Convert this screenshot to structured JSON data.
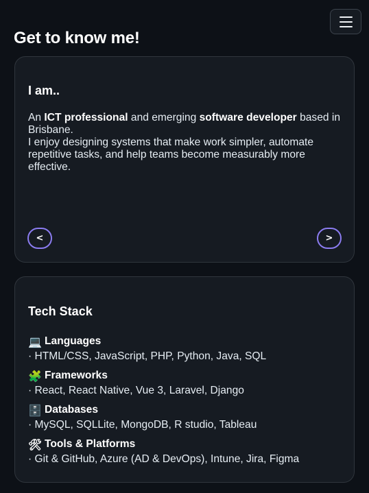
{
  "header": {
    "menu_icon": "hamburger-menu-icon"
  },
  "page": {
    "title": "Get to know me!"
  },
  "about": {
    "title": "I am..",
    "line1_pre": "An ",
    "line1_bold1": "ICT professional",
    "line1_mid": " and emerging ",
    "line1_bold2": "software developer",
    "line1_post": " based in Brisbane.",
    "line2": "I enjoy designing systems that make work simpler, automate repetitive tasks, and help teams become measurably more effective.",
    "prev_label": "<",
    "next_label": ">"
  },
  "stack": {
    "title": "Tech Stack",
    "groups": [
      {
        "icon": "laptop-icon",
        "glyph": "💻",
        "heading": "Languages",
        "items": "· HTML/CSS, JavaScript, PHP, Python, Java, SQL"
      },
      {
        "icon": "puzzle-icon",
        "glyph": "🧩",
        "heading": "Frameworks",
        "items": "· React, React Native, Vue 3, Laravel, Django"
      },
      {
        "icon": "file-cabinet-icon",
        "glyph": "🗄️",
        "heading": "Databases",
        "items": "· MySQL, SQLLite, MongoDB, R studio, Tableau"
      },
      {
        "icon": "tools-icon",
        "glyph": "🛠",
        "heading": "Tools & Platforms",
        "items": "· Git & GitHub, Azure (AD & DevOps), Intune, Jira, Figma"
      }
    ]
  },
  "colors": {
    "background": "#0d1117",
    "card": "#161b22",
    "accent": "#8b7cf0"
  }
}
